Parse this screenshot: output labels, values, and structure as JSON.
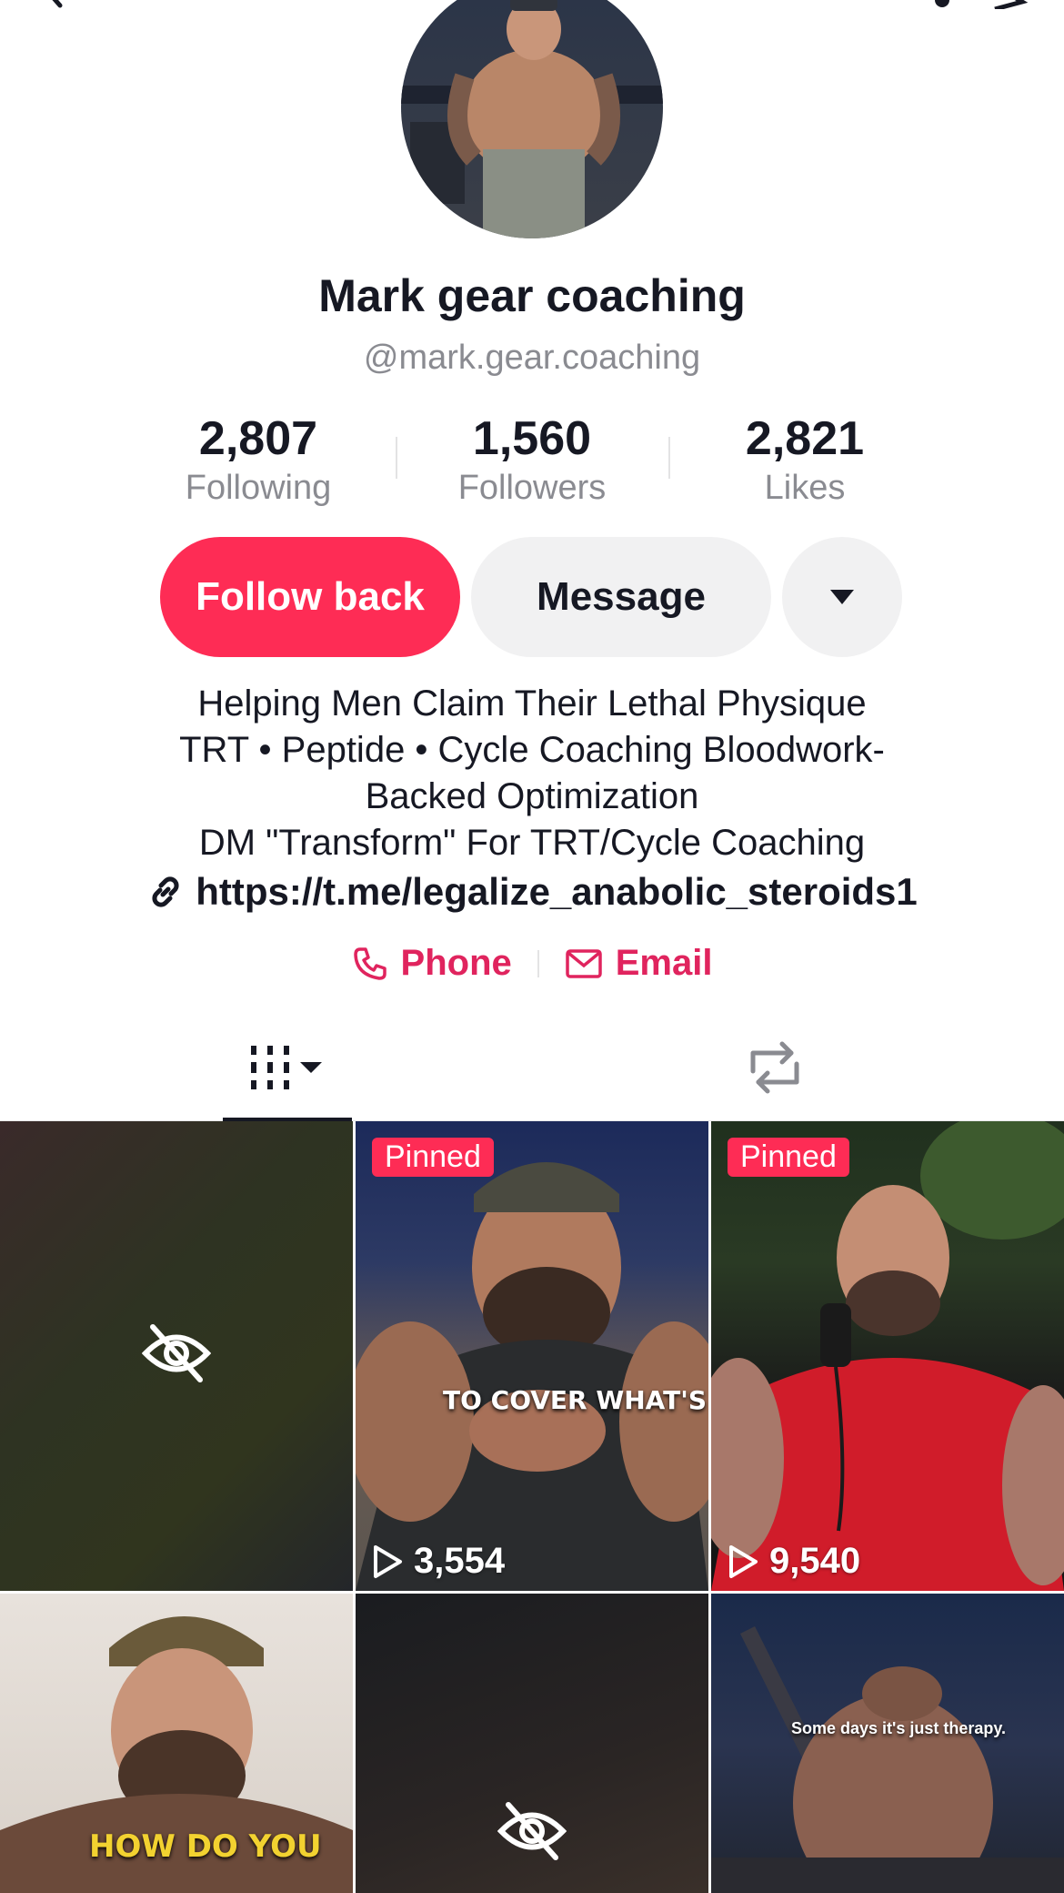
{
  "profile": {
    "display_name": "Mark gear coaching",
    "handle": "@mark.gear.coaching"
  },
  "stats": [
    {
      "value": "2,807",
      "label": "Following"
    },
    {
      "value": "1,560",
      "label": "Followers"
    },
    {
      "value": "2,821",
      "label": "Likes"
    }
  ],
  "actions": {
    "follow_back": "Follow back",
    "message": "Message"
  },
  "bio": {
    "lines": [
      "Helping Men Claim Their Lethal Physique",
      "TRT • Peptide • Cycle Coaching Bloodwork-",
      "Backed Optimization",
      "DM \"Transform\" For TRT/Cycle Coaching"
    ],
    "link": "https://t.me/legalize_anabolic_steroids1"
  },
  "contacts": {
    "phone": "Phone",
    "email": "Email"
  },
  "colors": {
    "accent": "#fe2c55",
    "contact": "#e0245e",
    "muted": "#8a8b91"
  },
  "videos": [
    {
      "hidden": true
    },
    {
      "pinned_label": "Pinned",
      "views": "3,554",
      "caption": "TO COVER WHAT'S"
    },
    {
      "pinned_label": "Pinned",
      "views": "9,540"
    },
    {
      "caption": "HOW DO YOU"
    },
    {
      "hidden": true
    },
    {
      "caption": "Some days it's just therapy."
    }
  ]
}
